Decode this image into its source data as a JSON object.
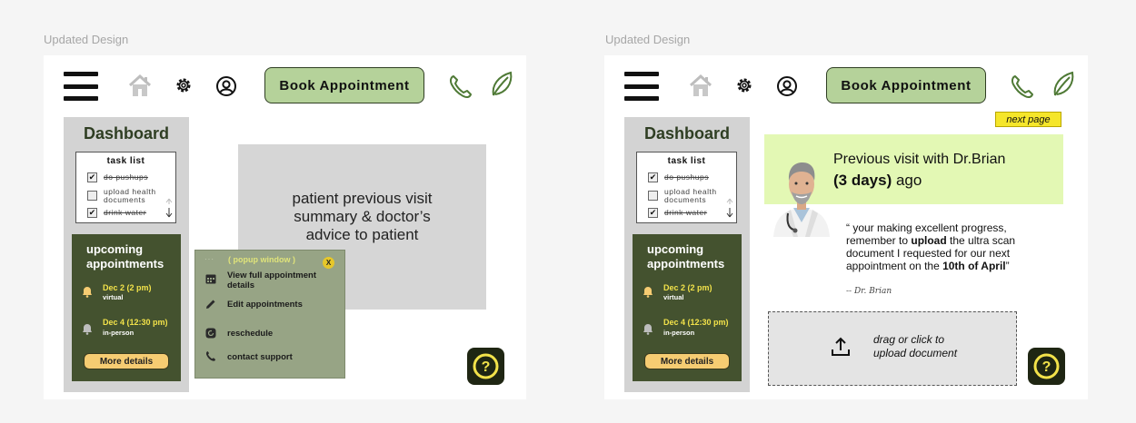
{
  "frames": [
    {
      "label": "Updated Design",
      "book_button": "Book Appointment",
      "dashboard_title": "Dashboard",
      "task_list": {
        "title": "task list",
        "items": [
          {
            "text": "do pushups",
            "done": true
          },
          {
            "text": "upload health documents",
            "done": false
          },
          {
            "text": "drink water",
            "done": true
          }
        ]
      },
      "appointments": {
        "title_line1": "upcoming",
        "title_line2": "appointments",
        "items": [
          {
            "date": "Dec 2 (2 pm)",
            "type": "virtual"
          },
          {
            "date": "Dec 4 (12:30 pm)",
            "type": "in-person"
          }
        ],
        "more_button": "More details"
      },
      "summary_text": "patient previous visit summary & doctor’s advice to patient",
      "popup": {
        "title": "( popup window )",
        "close_label": "X",
        "items": [
          "View full appointment details",
          "Edit appointments",
          "reschedule",
          "contact support"
        ]
      },
      "help_label": "?"
    },
    {
      "label": "Updated Design",
      "book_button": "Book Appointment",
      "next_page_label": "next page",
      "dashboard_title": "Dashboard",
      "task_list": {
        "title": "task list",
        "items": [
          {
            "text": "do pushups",
            "done": true
          },
          {
            "text": "upload health documents",
            "done": false
          },
          {
            "text": "drink water",
            "done": true
          }
        ]
      },
      "appointments": {
        "title_line1": "upcoming",
        "title_line2": "appointments",
        "items": [
          {
            "date": "Dec 2 (2 pm)",
            "type": "virtual"
          },
          {
            "date": "Dec 4 (12:30 pm)",
            "type": "in-person"
          }
        ],
        "more_button": "More details"
      },
      "visit": {
        "line1": "Previous visit with Dr.Brian",
        "days_bold": "(3 days)",
        "days_rest": " ago"
      },
      "quote": {
        "p1": "“ your making excellent progress, remember to ",
        "b1": "upload",
        "p2": " the ultra scan document I requested for our next appointment on the ",
        "b2": "10th of April",
        "p3": "”"
      },
      "signature": "-- Dr. Brian",
      "upload_line1": "drag or click to",
      "upload_line2": "upload document",
      "help_label": "?"
    }
  ],
  "colors": {
    "accent_green": "#b5d29a",
    "dark_green": "#44522f",
    "date_yellow": "#f2e24a",
    "button_orange": "#f6cc72",
    "popup_green": "#97a485",
    "visit_bg": "#e3f8b4"
  },
  "icons": [
    "menu-icon",
    "home-icon",
    "gear-icon",
    "user-icon",
    "phone-icon",
    "leaf-icon",
    "bell-icon",
    "calendar-icon",
    "pencil-icon",
    "reschedule-icon",
    "phone-support-icon",
    "upload-icon",
    "help-icon"
  ]
}
